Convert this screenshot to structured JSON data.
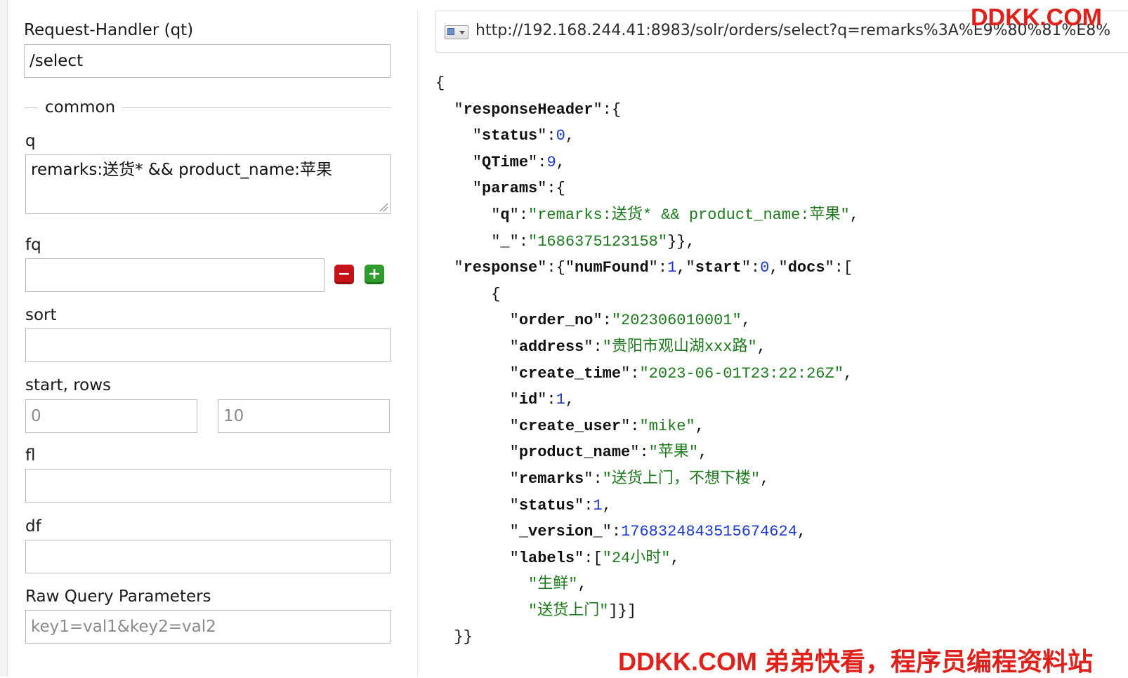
{
  "form": {
    "handler_label": "Request-Handler (qt)",
    "handler_value": "/select",
    "section_label": "common",
    "q_label": "q",
    "q_value": "remarks:送货* && product_name:苹果",
    "fq_label": "fq",
    "fq_remove_glyph": "−",
    "fq_add_glyph": "+",
    "sort_label": "sort",
    "start_rows_label": "start, rows",
    "start_placeholder": "0",
    "rows_placeholder": "10",
    "fl_label": "fl",
    "df_label": "df",
    "raw_label": "Raw Query Parameters",
    "raw_placeholder": "key1=val1&key2=val2"
  },
  "url_bar": {
    "url": "http://192.168.244.41:8983/solr/orders/select?q=remarks%3A%E9%80%81%E8%"
  },
  "response": {
    "status": "0",
    "qtime": "9",
    "param_q": "\"remarks:送货* && product_name:苹果\"",
    "param_underscore": "\"1686375123158\"",
    "num_found": "1",
    "start": "0",
    "doc": {
      "order_no": "\"202306010001\"",
      "address": "\"贵阳市观山湖xxx路\"",
      "create_time": "\"2023-06-01T23:22:26Z\"",
      "id": "1",
      "create_user": "\"mike\"",
      "product_name": "\"苹果\"",
      "remarks": "\"送货上门，不想下楼\"",
      "status": "1",
      "version": "1768324843515674624",
      "labels": [
        "\"24小时\"",
        "\"生鲜\"",
        "\"送货上门\""
      ]
    }
  },
  "watermarks": {
    "top": "DDKK.COM",
    "bottom": "DDKK.COM 弟弟快看，程序员编程资料站"
  },
  "colors": {
    "json_string": "#1d7a1d",
    "json_number": "#1a39d6",
    "watermark": "#e0201b"
  }
}
